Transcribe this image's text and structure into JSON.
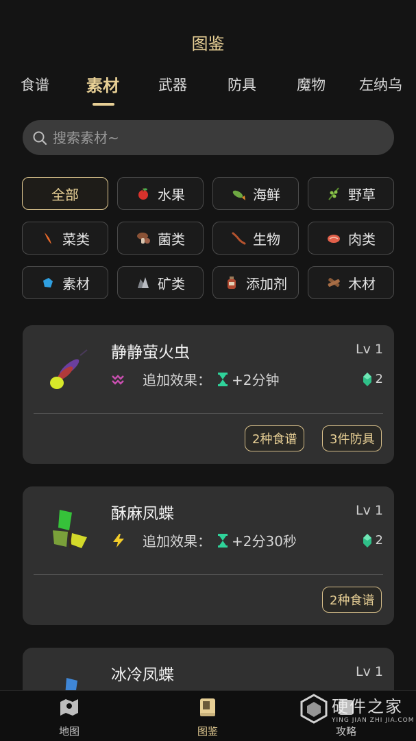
{
  "header": {
    "title": "图鉴"
  },
  "tabs": [
    {
      "label": "食谱"
    },
    {
      "label": "素材"
    },
    {
      "label": "武器"
    },
    {
      "label": "防具"
    },
    {
      "label": "魔物"
    },
    {
      "label": "左纳乌"
    }
  ],
  "active_tab": "素材",
  "search": {
    "placeholder": "搜索素材~",
    "value": ""
  },
  "filters": [
    {
      "label": "全部",
      "icon": "none"
    },
    {
      "label": "水果",
      "icon": "apple-icon"
    },
    {
      "label": "海鲜",
      "icon": "fish-icon"
    },
    {
      "label": "野草",
      "icon": "herb-icon"
    },
    {
      "label": "菜类",
      "icon": "carrot-icon"
    },
    {
      "label": "菌类",
      "icon": "mushroom-icon"
    },
    {
      "label": "生物",
      "icon": "lizard-icon"
    },
    {
      "label": "肉类",
      "icon": "meat-icon"
    },
    {
      "label": "素材",
      "icon": "crystal-icon"
    },
    {
      "label": "矿类",
      "icon": "ore-icon"
    },
    {
      "label": "添加剂",
      "icon": "bottle-icon"
    },
    {
      "label": "木材",
      "icon": "wood-icon"
    }
  ],
  "active_filter": "全部",
  "items": [
    {
      "name": "静静萤火虫",
      "level": "Lv 1",
      "effect_icon": "stealth-icon",
      "effect_label": "追加效果：",
      "effect_value": "+2分钟",
      "gem_count": "2",
      "tags": [
        "2种食谱",
        "3件防具"
      ]
    },
    {
      "name": "酥麻凤蝶",
      "level": "Lv 1",
      "effect_icon": "lightning-icon",
      "effect_label": "追加效果：",
      "effect_value": "+2分30秒",
      "gem_count": "2",
      "tags": [
        "2种食谱"
      ]
    },
    {
      "name": "冰冷凤蝶",
      "level": "Lv 1"
    }
  ],
  "bottom_nav": [
    {
      "label": "地图",
      "icon": "map-icon"
    },
    {
      "label": "图鉴",
      "icon": "book-icon"
    },
    {
      "label": "攻略",
      "icon": "guide-icon"
    }
  ],
  "watermark": {
    "title": "硬件之家",
    "subtitle": "YING JIAN ZHI JIA.COM"
  },
  "colors": {
    "accent": "#e7cf95",
    "background": "#141414",
    "card": "#303030",
    "effect_green": "#2fd39a"
  }
}
